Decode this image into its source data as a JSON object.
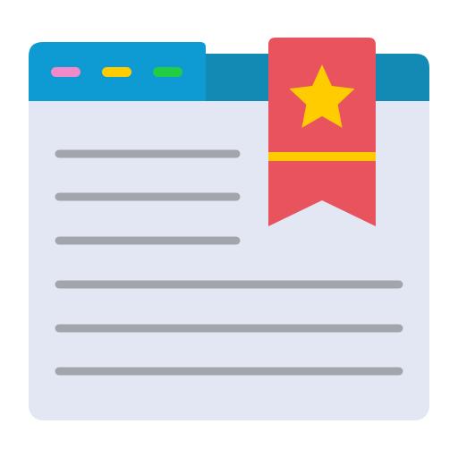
{
  "icon": {
    "name": "bookmarked-browser-page-icon",
    "colors": {
      "window_body": "#E3E7F3",
      "title_bar_active": "#0E9BD3",
      "title_bar_rest": "#138AB3",
      "dot_pink": "#F08AC8",
      "dot_yellow": "#FFCC00",
      "dot_green": "#22CC44",
      "text_line": "#A2A6AC",
      "bookmark": "#E8535E",
      "bookmark_stripe": "#FFCC00",
      "star": "#FFCC00"
    },
    "window_dots": [
      "pink",
      "yellow",
      "green"
    ],
    "text_line_count": 6
  }
}
